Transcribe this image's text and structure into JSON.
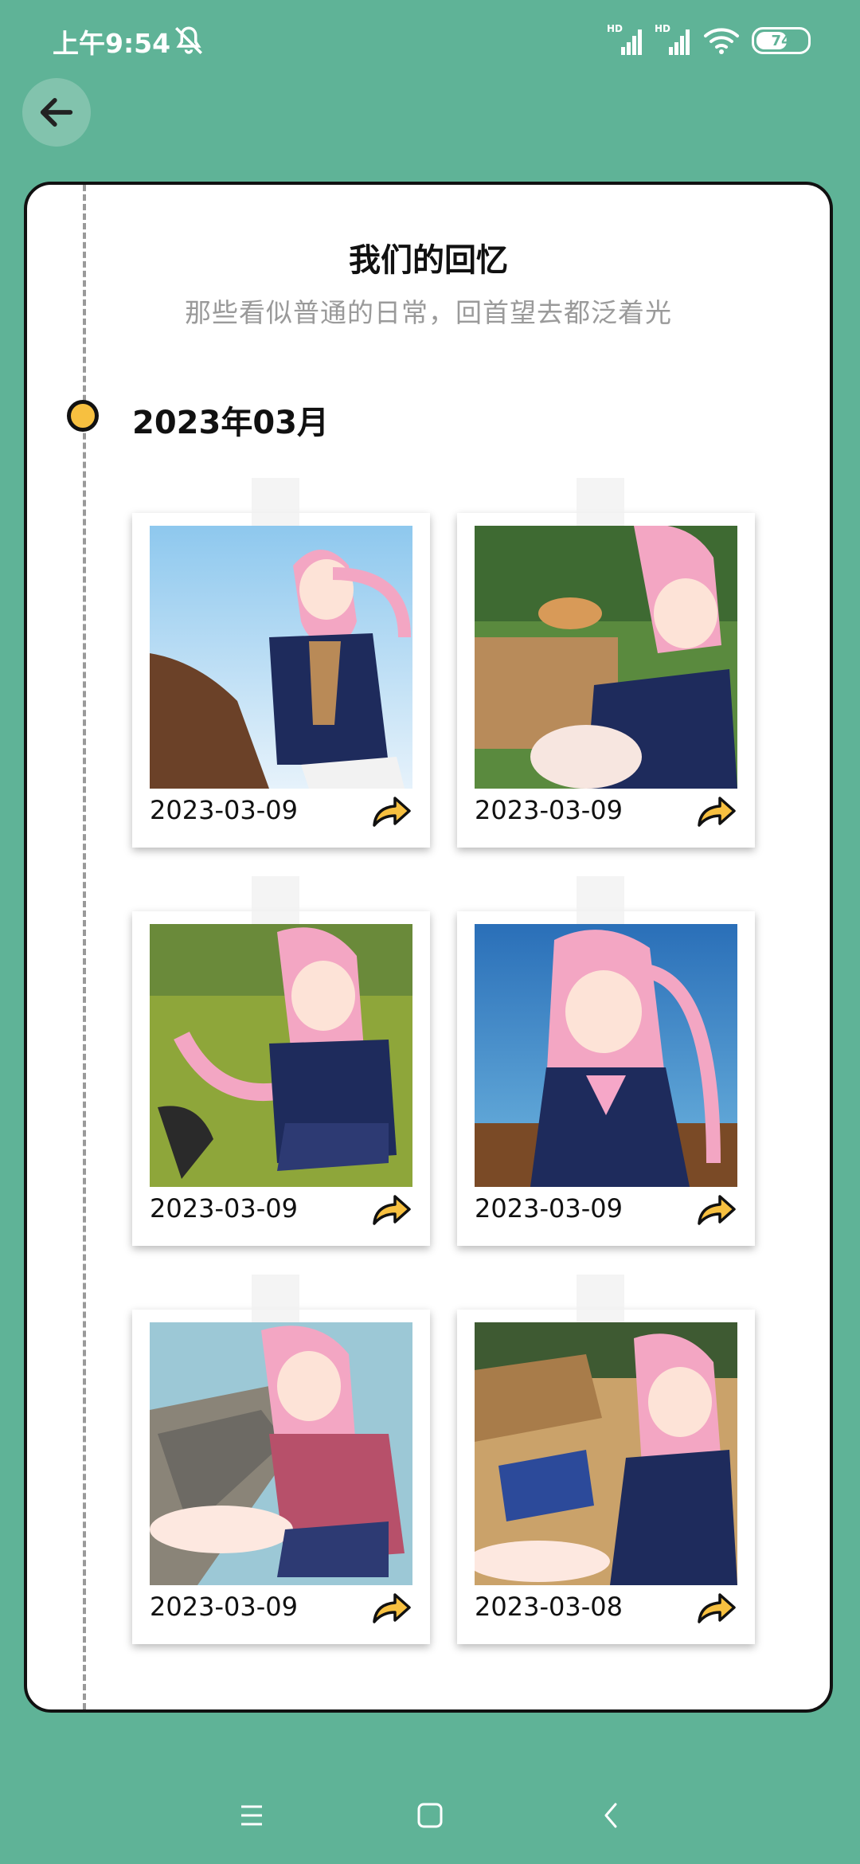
{
  "status_bar": {
    "time": "上午9:54",
    "signal1_label": "HD",
    "signal2_label": "HD",
    "battery": "74"
  },
  "header": {
    "title": "我们的回忆",
    "subtitle": "那些看似普通的日常，回首望去都泛着光"
  },
  "timeline": {
    "month": "2023年03月",
    "photos": [
      {
        "date": "2023-03-09"
      },
      {
        "date": "2023-03-09"
      },
      {
        "date": "2023-03-09"
      },
      {
        "date": "2023-03-09"
      },
      {
        "date": "2023-03-09"
      },
      {
        "date": "2023-03-08"
      }
    ]
  },
  "colors": {
    "background": "#5fb397",
    "dot": "#f7c040",
    "share_icon": "#f7c040"
  }
}
